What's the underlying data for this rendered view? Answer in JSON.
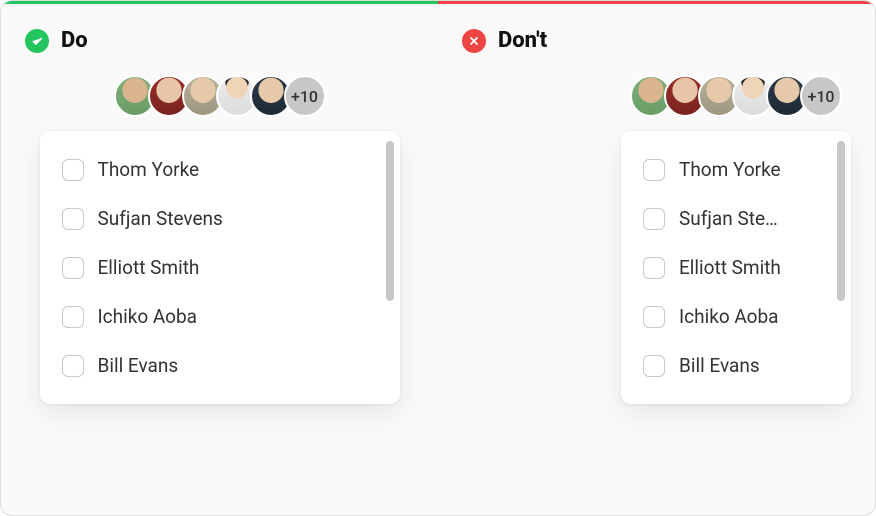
{
  "do": {
    "heading": "Do"
  },
  "dont": {
    "heading": "Don't"
  },
  "avatars": {
    "overflow_label": "+10"
  },
  "left": {
    "items": [
      {
        "label": "Thom Yorke"
      },
      {
        "label": "Sufjan Stevens"
      },
      {
        "label": "Elliott Smith"
      },
      {
        "label": "Ichiko Aoba"
      },
      {
        "label": "Bill Evans"
      }
    ]
  },
  "right": {
    "items": [
      {
        "label": "Thom Yorke"
      },
      {
        "label": "Sufjan Ste…"
      },
      {
        "label": "Elliott Smith"
      },
      {
        "label": "Ichiko Aoba"
      },
      {
        "label": "Bill Evans"
      }
    ]
  }
}
